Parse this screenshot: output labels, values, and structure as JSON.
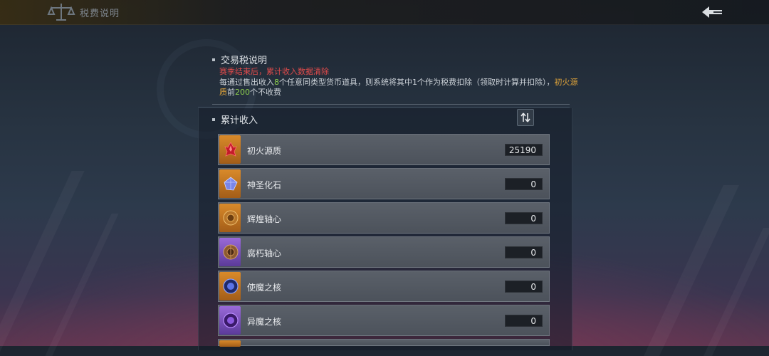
{
  "header": {
    "title": "税费说明",
    "title_icon": "scales-icon",
    "back_icon": "back-arrow-icon"
  },
  "info": {
    "title": "交易税说明",
    "warning": "赛季结束后，累计收入数据清除",
    "desc_prefix": "每通过售出收入",
    "desc_num1": "8",
    "desc_mid": "个任意同类型货币道具，则系统将其中1个作为税费扣除（领取时计算并扣除），",
    "desc_item": "初火源质",
    "desc_mid2": "前",
    "desc_num2": "200",
    "desc_suffix": "个不收费"
  },
  "income": {
    "title": "累计收入",
    "sort_icon": "sort-toggle-icon",
    "items": [
      {
        "name": "初火源质",
        "value": "25190",
        "rarity": "orange",
        "icon": "red-crystal-icon"
      },
      {
        "name": "神圣化石",
        "value": "0",
        "rarity": "orange",
        "icon": "blue-crystal-icon"
      },
      {
        "name": "辉煌轴心",
        "value": "0",
        "rarity": "orange",
        "icon": "gold-axis-icon"
      },
      {
        "name": "腐朽轴心",
        "value": "0",
        "rarity": "purple",
        "icon": "bronze-axis-icon"
      },
      {
        "name": "使魔之核",
        "value": "0",
        "rarity": "orange",
        "icon": "blue-core-icon"
      },
      {
        "name": "异魔之核",
        "value": "0",
        "rarity": "purple",
        "icon": "purple-core-icon"
      }
    ]
  },
  "colors": {
    "accent_orange": "#e0a43a",
    "accent_green": "#8fd14f",
    "warning_red": "#e24b4b"
  }
}
